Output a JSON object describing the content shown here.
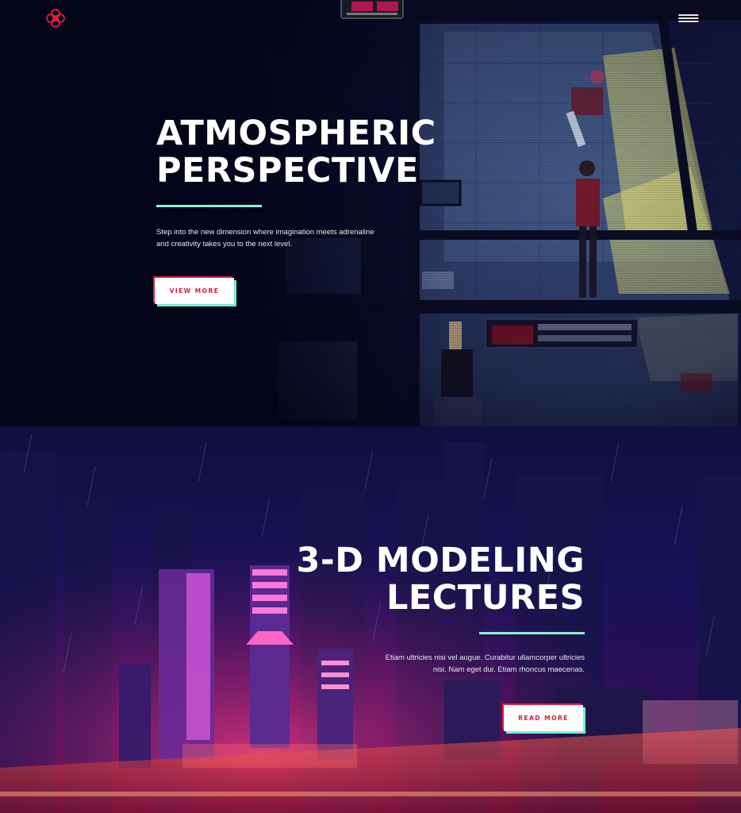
{
  "nav": {
    "logo_icon": "red-knot-logo-icon",
    "menu_icon": "hamburger-menu-icon"
  },
  "hero_1": {
    "title": "ATMOSPHERIC\nPERSPECTIVE",
    "body": "Step into the new dimension where imagination meets adrenaline and creativity takes you to the next level.",
    "button_label": "VIEW MORE"
  },
  "hero_2": {
    "title": "3-D MODELING\nLECTURES",
    "body": "Etiam ultricies nisi vel augue. Curabitur ullamcorper ultricies nisi. Nam eget dui. Etiam rhoncus maecenas.",
    "button_label": "READ MORE"
  },
  "colors": {
    "accent_red": "#e0203f",
    "accent_mint": "#8ef0d4",
    "background": "#07071c"
  }
}
